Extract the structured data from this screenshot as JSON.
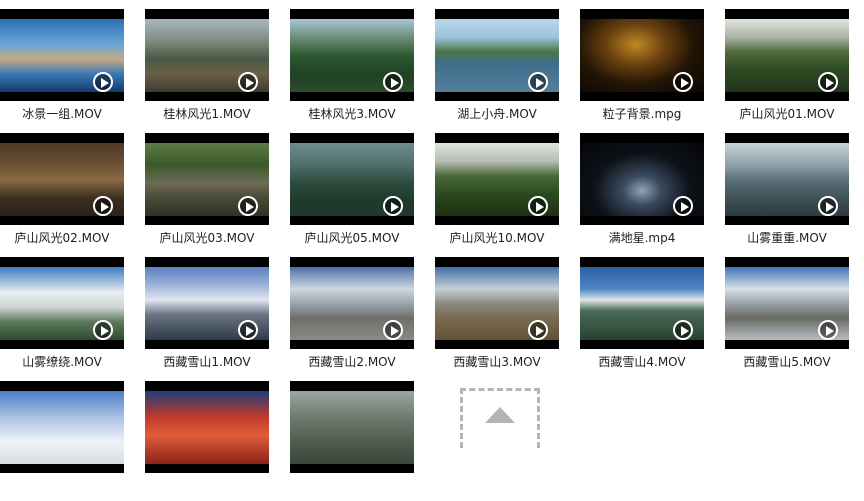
{
  "files": [
    {
      "name": "冰景一组.MOV"
    },
    {
      "name": "桂林风光1.MOV"
    },
    {
      "name": "桂林风光3.MOV"
    },
    {
      "name": "湖上小舟.MOV"
    },
    {
      "name": "粒子背景.mpg"
    },
    {
      "name": "庐山风光01.MOV"
    },
    {
      "name": "庐山风光02.MOV"
    },
    {
      "name": "庐山风光03.MOV"
    },
    {
      "name": "庐山风光05.MOV"
    },
    {
      "name": "庐山风光10.MOV"
    },
    {
      "name": "满地星.mp4"
    },
    {
      "name": "山雾重重.MOV"
    },
    {
      "name": "山雾缭绕.MOV"
    },
    {
      "name": "西藏雪山1.MOV"
    },
    {
      "name": "西藏雪山2.MOV"
    },
    {
      "name": "西藏雪山3.MOV"
    },
    {
      "name": "西藏雪山4.MOV"
    },
    {
      "name": "西藏雪山5.MOV"
    },
    {
      "name": ""
    },
    {
      "name": ""
    },
    {
      "name": ""
    }
  ],
  "colors": {
    "label": "#1e1e1e",
    "letterbox": "#000000",
    "play_icon": "#ffffff",
    "upload_placeholder": "#b4b4b4"
  }
}
